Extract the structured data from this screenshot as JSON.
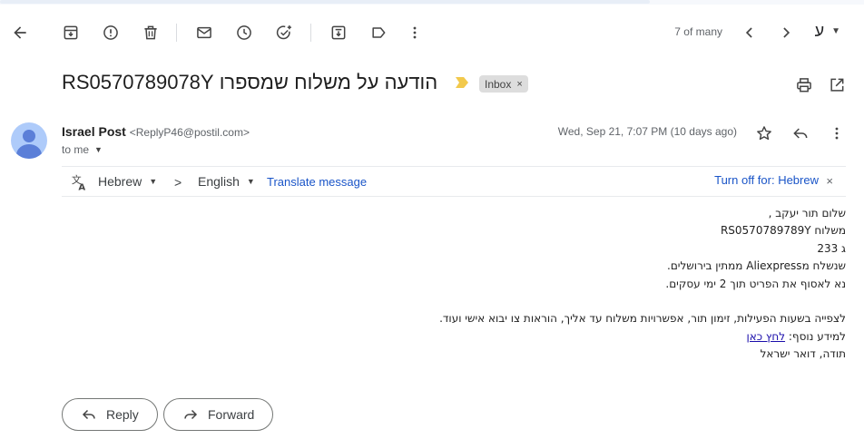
{
  "toolbar": {
    "pager": "7 of many",
    "language": "ע"
  },
  "subject": {
    "text": "הודעה על משלוח שמספרו RS0570789078Y",
    "label": "Inbox",
    "label_remove": "×"
  },
  "sender": {
    "name": "Israel Post",
    "email": "<ReplyP46@postil.com>",
    "to": "to me",
    "date": "Wed, Sep 21, 7:07 PM (10 days ago)"
  },
  "translate": {
    "from": "Hebrew",
    "arrow": ">",
    "to": "English",
    "translate_label": "Translate message",
    "turn_off_label": "Turn off for: Hebrew",
    "close": "×"
  },
  "body": {
    "lines": [
      "שלום תור יעקב ,",
      "משלוח RS0570789789Y",
      "ג 233",
      "שנשלח מAliexpress ממתין בירושלים.",
      "נא לאסוף את הפריט תוך 2 ימי עסקים.",
      "",
      "לצפייה בשעות הפעילות, זימון תור, אפשרויות משלוח עד אליך, הוראות צו יבוא אישי ועוד."
    ],
    "more_info_prefix": "למידע נוסף: ",
    "more_info_link": "לחץ כאן",
    "signature": "תודה, דואר ישראל"
  },
  "actions": {
    "reply": "Reply",
    "forward": "Forward"
  },
  "colors": {
    "link": "#1a55c8",
    "avatar": "#aecbfa",
    "importance": "#f2c94c"
  }
}
